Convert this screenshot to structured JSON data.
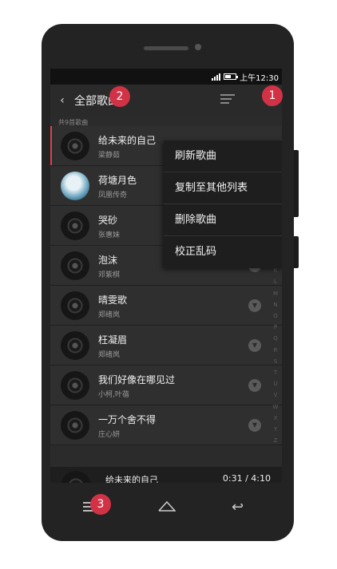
{
  "status_bar": {
    "time": "上午12:30"
  },
  "app_bar": {
    "title": "全部歌曲",
    "back_icon": "chevron-left-icon",
    "playlist_icon": "playlist-icon",
    "more_icon": "more-vert-icon"
  },
  "song_count": "共9首歌曲",
  "songs": [
    {
      "title": "给未来的自己",
      "artist": "梁静茹"
    },
    {
      "title": "荷塘月色",
      "artist": "凤凰传奇"
    },
    {
      "title": "哭砂",
      "artist": "张惠妹"
    },
    {
      "title": "泡沫",
      "artist": "邓紫棋"
    },
    {
      "title": "晴雯歌",
      "artist": "郑绪岚"
    },
    {
      "title": "枉凝眉",
      "artist": "郑绪岚"
    },
    {
      "title": "我们好像在哪见过",
      "artist": "小柯,叶蓓"
    },
    {
      "title": "一万个舍不得",
      "artist": "庄心妍"
    }
  ],
  "index_letters": [
    "J",
    "K",
    "L",
    "M",
    "N",
    "O",
    "P",
    "Q",
    "R",
    "S",
    "T",
    "U",
    "V",
    "W",
    "X",
    "Y",
    "Z"
  ],
  "menu": [
    "刷新歌曲",
    "复制至其他列表",
    "删除歌曲",
    "校正乱码"
  ],
  "now_playing": {
    "title": "给未来的自己",
    "time": "0:31 / 4:10"
  },
  "badges": [
    "1",
    "2",
    "3"
  ],
  "colors": {
    "accent": "#d23246",
    "active_bar": "#e0404c"
  }
}
